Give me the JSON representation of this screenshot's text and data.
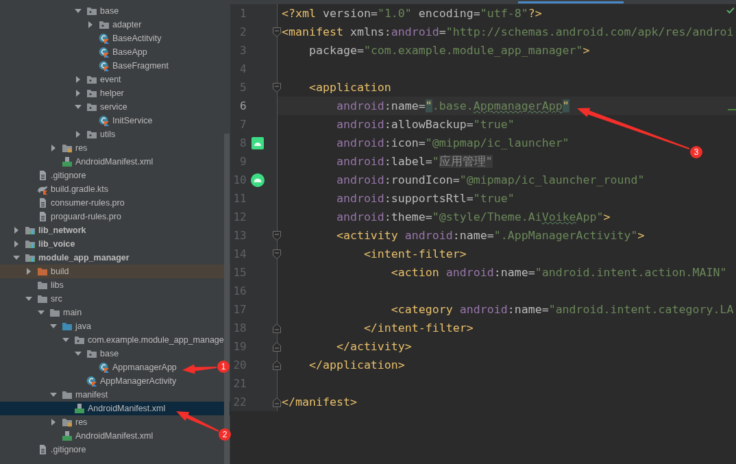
{
  "project_tree": [
    {
      "children": [
        {
          "children": [
            {
              "children": [
                {
                  "children": [
                    {
                      "children": [
                        {
                          "label": "base",
                          "kind": "package",
                          "expanded": true,
                          "selected": false,
                          "children": [
                            {
                              "label": "adapter",
                              "kind": "package",
                              "expanded": false,
                              "selected": false
                            },
                            {
                              "label": "BaseActitvity",
                              "kind": "kotlin-class",
                              "selected": false
                            },
                            {
                              "label": "BaseApp",
                              "kind": "kotlin-class",
                              "selected": false
                            },
                            {
                              "label": "BaseFragment",
                              "kind": "kotlin-class",
                              "selected": false
                            }
                          ]
                        },
                        {
                          "label": "event",
                          "kind": "package",
                          "expanded": false,
                          "selected": false
                        },
                        {
                          "label": "helper",
                          "kind": "package",
                          "expanded": false,
                          "selected": false
                        },
                        {
                          "label": "service",
                          "kind": "package",
                          "expanded": true,
                          "selected": false,
                          "children": [
                            {
                              "label": "InitService",
                              "kind": "kotlin-class",
                              "selected": false
                            }
                          ]
                        },
                        {
                          "label": "utils",
                          "kind": "package",
                          "expanded": false,
                          "selected": false
                        }
                      ]
                    }
                  ]
                },
                {
                  "label": "res",
                  "kind": "res-folder",
                  "expanded": false,
                  "selected": false
                },
                {
                  "label": "AndroidManifest.xml",
                  "kind": "manifest",
                  "selected": false
                }
              ]
            }
          ]
        },
        {
          "label": ".gitignore",
          "kind": "text-file",
          "selected": false
        },
        {
          "label": "build.gradle.kts",
          "kind": "gradle",
          "selected": false
        },
        {
          "label": "consumer-rules.pro",
          "kind": "text-file",
          "selected": false
        },
        {
          "label": "proguard-rules.pro",
          "kind": "text-file",
          "selected": false
        }
      ]
    },
    {
      "label": "lib_network",
      "kind": "module",
      "expanded": false,
      "selected": false
    },
    {
      "label": "lib_voice",
      "kind": "module",
      "expanded": false,
      "selected": false
    },
    {
      "label": "module_app_manager",
      "kind": "module",
      "expanded": true,
      "selected": false,
      "children": [
        {
          "label": "build",
          "kind": "build-folder",
          "expanded": false,
          "selected": false
        },
        {
          "label": "libs",
          "kind": "folder",
          "selected": false
        },
        {
          "label": "src",
          "kind": "folder",
          "expanded": true,
          "selected": false,
          "children": [
            {
              "label": "main",
              "kind": "folder",
              "expanded": true,
              "selected": false,
              "children": [
                {
                  "label": "java",
                  "kind": "source-folder",
                  "expanded": true,
                  "selected": false,
                  "children": [
                    {
                      "label": "com.example.module_app_manage",
                      "kind": "package",
                      "expanded": true,
                      "selected": false,
                      "children": [
                        {
                          "label": "base",
                          "kind": "package",
                          "expanded": true,
                          "selected": false,
                          "children": [
                            {
                              "label": "AppmanagerApp",
                              "kind": "kotlin-class",
                              "selected": false
                            }
                          ]
                        },
                        {
                          "label": "AppManagerActivity",
                          "kind": "kotlin-class",
                          "selected": false
                        }
                      ]
                    }
                  ]
                },
                {
                  "label": "manifest",
                  "kind": "folder",
                  "expanded": true,
                  "selected": false,
                  "children": [
                    {
                      "label": "AndroidManifest.xml",
                      "kind": "manifest",
                      "selected": true
                    }
                  ]
                },
                {
                  "label": "res",
                  "kind": "res-folder",
                  "expanded": false,
                  "selected": false
                },
                {
                  "label": "AndroidManifest.xml",
                  "kind": "manifest",
                  "selected": false
                }
              ]
            }
          ]
        },
        {
          "label": ".gitignore",
          "kind": "text-file",
          "selected": false
        }
      ]
    }
  ],
  "editor": {
    "lines": [
      {
        "number": "1",
        "tokens": [
          {
            "kind": "tag",
            "text": "<?xml "
          },
          {
            "kind": "attr",
            "text": "version="
          },
          {
            "kind": "str",
            "text": "\"1.0\""
          },
          {
            "kind": "attr",
            "text": " encoding="
          },
          {
            "kind": "str",
            "text": "\"utf-8\""
          },
          {
            "kind": "tag",
            "text": "?>"
          }
        ]
      },
      {
        "number": "2",
        "fold_mark": {
          "kind": "start"
        },
        "tokens": [
          {
            "kind": "tag",
            "text": "<manifest "
          },
          {
            "kind": "attr",
            "text": "xmlns:"
          },
          {
            "kind": "ns",
            "text": "android"
          },
          {
            "kind": "attr",
            "text": "="
          },
          {
            "kind": "str",
            "text": "\"http://schemas.android.com/apk/res/androi"
          }
        ]
      },
      {
        "number": "3",
        "tokens": [
          {
            "kind": "attr",
            "text": "    package="
          },
          {
            "kind": "str",
            "text": "\"com.example.module_app_manager\""
          },
          {
            "kind": "tag",
            "text": ">"
          }
        ]
      },
      {
        "number": "4"
      },
      {
        "number": "5",
        "fold_mark": {
          "kind": "start"
        },
        "tokens": [
          {
            "kind": "tag",
            "text": "    <application"
          }
        ]
      },
      {
        "number": "6",
        "current": true,
        "tokens": [
          {
            "kind": "ns",
            "text": "        android"
          },
          {
            "kind": "attr",
            "text": ":name="
          },
          {
            "kind": "brace",
            "text": "\""
          },
          {
            "kind": "str",
            "text": ".base."
          },
          {
            "kind": "typo",
            "text": "AppmanagerApp"
          },
          {
            "kind": "brace",
            "text": "\""
          }
        ]
      },
      {
        "number": "7",
        "tokens": [
          {
            "kind": "ns",
            "text": "        android"
          },
          {
            "kind": "attr",
            "text": ":allowBackup="
          },
          {
            "kind": "str",
            "text": "\"true\""
          }
        ]
      },
      {
        "number": "8",
        "gutter_mark": {
          "kind": "android-square"
        },
        "tokens": [
          {
            "kind": "ns",
            "text": "        android"
          },
          {
            "kind": "attr",
            "text": ":icon="
          },
          {
            "kind": "str",
            "text": "\"@mipmap/ic_launcher\""
          }
        ]
      },
      {
        "number": "9",
        "tokens": [
          {
            "kind": "ns",
            "text": "        android"
          },
          {
            "kind": "attr",
            "text": ":label="
          },
          {
            "kind": "str",
            "text": "\""
          },
          {
            "kind": "folded",
            "text": "应用管理\""
          }
        ]
      },
      {
        "number": "10",
        "gutter_mark": {
          "kind": "android-round"
        },
        "tokens": [
          {
            "kind": "ns",
            "text": "        android"
          },
          {
            "kind": "attr",
            "text": ":roundIcon="
          },
          {
            "kind": "str",
            "text": "\"@mipmap/ic_launcher_round\""
          }
        ]
      },
      {
        "number": "11",
        "tokens": [
          {
            "kind": "ns",
            "text": "        android"
          },
          {
            "kind": "attr",
            "text": ":supportsRtl="
          },
          {
            "kind": "str",
            "text": "\"true\""
          }
        ]
      },
      {
        "number": "12",
        "tokens": [
          {
            "kind": "ns",
            "text": "        android"
          },
          {
            "kind": "attr",
            "text": ":theme="
          },
          {
            "kind": "str",
            "text": "\"@style/Theme.Ai"
          },
          {
            "kind": "typo",
            "text": "Voike"
          },
          {
            "kind": "str",
            "text": "App\""
          },
          {
            "kind": "tag",
            "text": ">"
          }
        ]
      },
      {
        "number": "13",
        "fold_mark": {
          "kind": "start"
        },
        "tokens": [
          {
            "kind": "tag",
            "text": "        <activity "
          },
          {
            "kind": "ns",
            "text": "android"
          },
          {
            "kind": "attr",
            "text": ":name="
          },
          {
            "kind": "str",
            "text": "\".AppManagerActivity\""
          },
          {
            "kind": "tag",
            "text": ">"
          }
        ]
      },
      {
        "number": "14",
        "fold_mark": {
          "kind": "start"
        },
        "tokens": [
          {
            "kind": "tag",
            "text": "            <intent-filter>"
          }
        ]
      },
      {
        "number": "15",
        "tokens": [
          {
            "kind": "tag",
            "text": "                <action "
          },
          {
            "kind": "ns",
            "text": "android"
          },
          {
            "kind": "attr",
            "text": ":name="
          },
          {
            "kind": "str",
            "text": "\"android.intent.action.MAIN\""
          }
        ]
      },
      {
        "number": "16"
      },
      {
        "number": "17",
        "tokens": [
          {
            "kind": "tag",
            "text": "                <category "
          },
          {
            "kind": "ns",
            "text": "android"
          },
          {
            "kind": "attr",
            "text": ":name="
          },
          {
            "kind": "str",
            "text": "\"android.intent.category.LA"
          }
        ]
      },
      {
        "number": "18",
        "fold_mark": {
          "kind": "end"
        },
        "tokens": [
          {
            "kind": "tag",
            "text": "            </intent-filter>"
          }
        ]
      },
      {
        "number": "19",
        "fold_mark": {
          "kind": "end"
        },
        "tokens": [
          {
            "kind": "tag",
            "text": "        </activity>"
          }
        ]
      },
      {
        "number": "20",
        "fold_mark": {
          "kind": "end"
        },
        "tokens": [
          {
            "kind": "tag",
            "text": "    </application>"
          }
        ]
      },
      {
        "number": "21"
      },
      {
        "number": "22",
        "fold_mark": {
          "kind": "end"
        },
        "tokens": [
          {
            "kind": "tag",
            "text": "</manifest>"
          }
        ]
      }
    ]
  },
  "annotations": [
    {
      "label": "1"
    },
    {
      "label": "2"
    },
    {
      "label": "3"
    }
  ]
}
